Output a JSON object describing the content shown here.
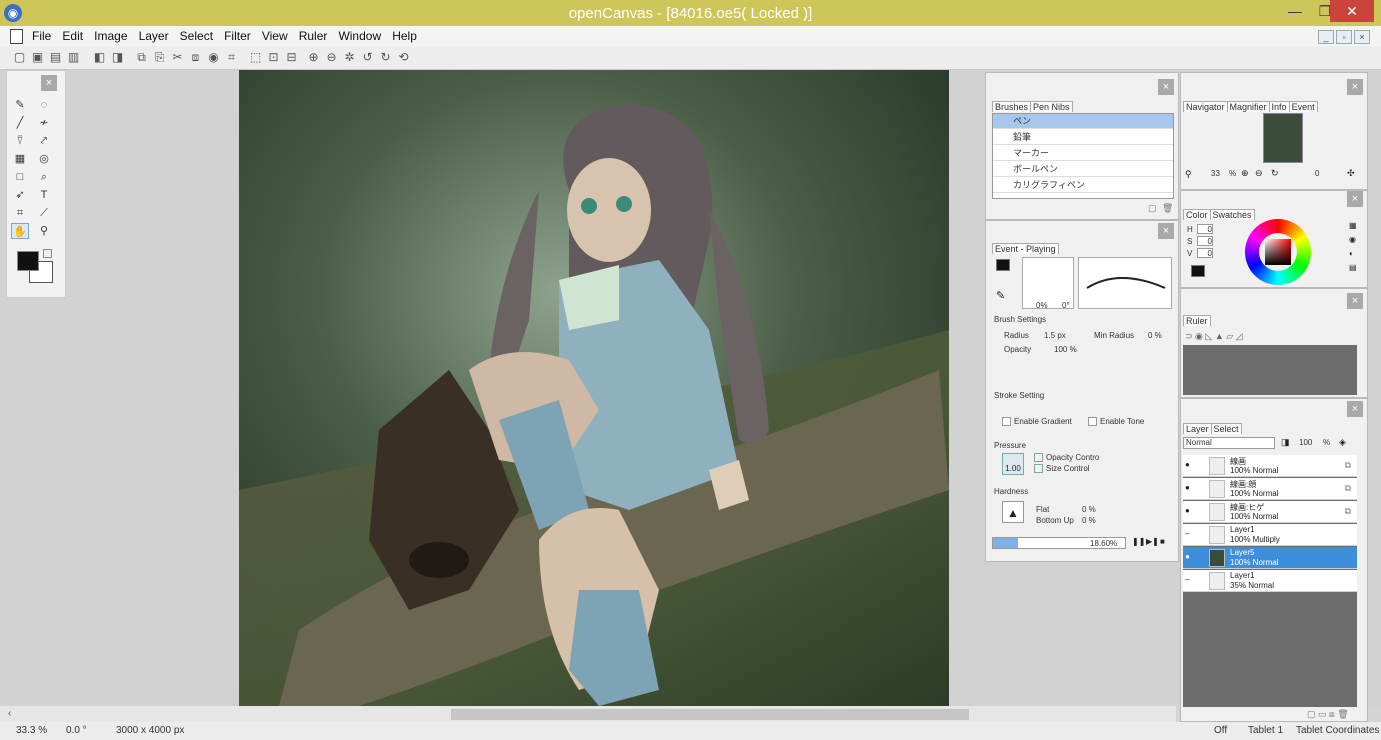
{
  "window": {
    "title": "openCanvas - [84016.oe5( Locked )]"
  },
  "menu": [
    "File",
    "Edit",
    "Image",
    "Layer",
    "Select",
    "Filter",
    "View",
    "Ruler",
    "Window",
    "Help"
  ],
  "brushes_panel": {
    "tabs": [
      "Brushes",
      "Pen Nibs"
    ],
    "items": [
      "ペン",
      "鉛筆",
      "マーカー",
      "ボールペン",
      "カリグラフィペン"
    ],
    "selected_index": 0
  },
  "event_panel": {
    "tab": "Event - Playing",
    "preview_values": [
      "0%",
      "0°"
    ],
    "brush_settings_label": "Brush Settings",
    "radius_label": "Radius",
    "radius_value": "1.5 px",
    "min_radius_label": "Min Radius",
    "min_radius_value": "0 %",
    "opacity_label": "Opacity",
    "opacity_value": "100 %",
    "stroke_setting_label": "Stroke Setting",
    "enable_gradient": "Enable Gradient",
    "enable_tone": "Enable Tone",
    "pressure_label": "Pressure",
    "pressure_value": "1.00",
    "opacity_control": "Opacity Contro",
    "size_control": "Size Control",
    "hardness_label": "Hardness",
    "flat_label": "Flat",
    "flat_value": "0 %",
    "bottom_up_label": "Bottom Up",
    "bottom_up_value": "0 %",
    "progress_text": "18.60%",
    "progress": 0.186
  },
  "navigator_panel": {
    "tabs": [
      "Navigator",
      "Magnifier",
      "Info",
      "Event"
    ],
    "zoom": "33",
    "zoom_unit": "%",
    "rotation": "0"
  },
  "color_panel": {
    "tabs": [
      "Color",
      "Swatches"
    ],
    "h_label": "H",
    "h_value": "0",
    "s_label": "S",
    "s_value": "0",
    "v_label": "V",
    "v_value": "0"
  },
  "ruler_panel": {
    "tab": "Ruler"
  },
  "layer_panel": {
    "tabs": [
      "Layer",
      "Select"
    ],
    "blend_mode": "Normal",
    "opacity": "100",
    "opacity_unit": "%",
    "layers": [
      {
        "name": "線画",
        "mode": "100% Normal"
      },
      {
        "name": "線画:顔",
        "mode": "100% Normal"
      },
      {
        "name": "線画:ヒゲ",
        "mode": "100% Normal"
      },
      {
        "name": "Layer1",
        "mode": "100% Multiply"
      },
      {
        "name": "Layer5",
        "mode": "100% Normal",
        "selected": true
      },
      {
        "name": "Layer1",
        "mode": "35% Normal"
      }
    ]
  },
  "status": {
    "zoom": "33.3 %",
    "angle": "0.0 °",
    "size": "3000 x 4000 px",
    "tablet_off": "Off",
    "tablet": "Tablet 1",
    "tablet_coords": "Tablet Coordinates"
  },
  "colors": {
    "titlebar": "#cfc65a",
    "selection": "#3d8fdc",
    "close": "#c9453b"
  }
}
